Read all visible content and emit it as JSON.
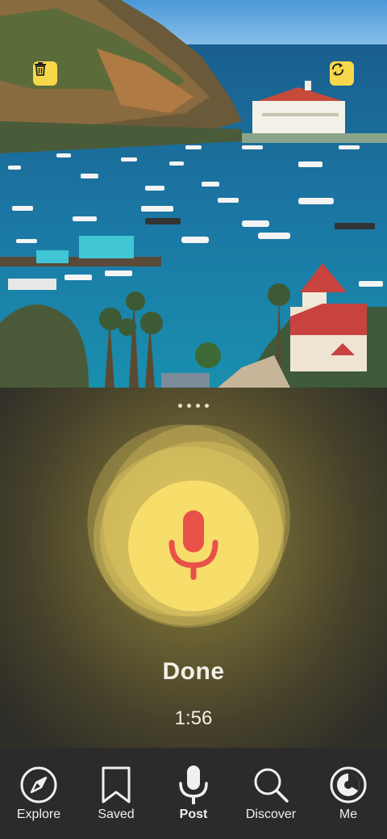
{
  "photo": {
    "delete_icon": "trash-icon",
    "swap_icon": "swap-icon"
  },
  "recorder": {
    "status": "Done",
    "timer": "1:56",
    "mic_color": "#e8514a",
    "button_color": "#f7dd6a"
  },
  "nav": {
    "items": [
      {
        "label": "Explore",
        "icon": "compass-icon"
      },
      {
        "label": "Saved",
        "icon": "bookmark-icon"
      },
      {
        "label": "Post",
        "icon": "microphone-icon"
      },
      {
        "label": "Discover",
        "icon": "search-icon"
      },
      {
        "label": "Me",
        "icon": "profile-icon"
      }
    ],
    "active": "Post"
  }
}
